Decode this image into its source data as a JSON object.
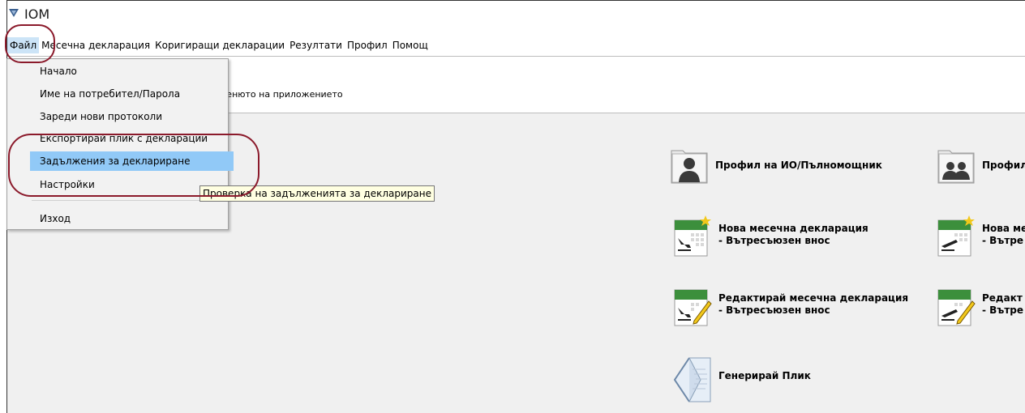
{
  "app": {
    "title": "IOM"
  },
  "menubar": {
    "items": [
      "Файл",
      "Месечна декларация",
      "Коригиращи декларации",
      "Резултати",
      "Профил",
      "Помощ"
    ]
  },
  "info_text": "менюто на приложението",
  "file_menu": {
    "items": [
      "Начало",
      "Име на потребител/Парола",
      "Зареди нови протоколи",
      "Експортирай плик с декларации",
      "Задължения за деклариране",
      "Настройки",
      "Изход"
    ],
    "highlighted": "Задължения за деклариране"
  },
  "tooltip": "Проверка на задълженията за деклариране",
  "tiles": {
    "profile_io": {
      "line1": "Профил на ИО/Пълномощник",
      "icon": "person-folder-icon"
    },
    "profile_2": {
      "line1": "Профил",
      "icon": "group-folder-icon"
    },
    "new_decl": {
      "line1": "Нова месечна декларация",
      "line2": "- Вътресъюзен внос",
      "icon": "calendar-arrival-icon"
    },
    "new_decl_2": {
      "line1": "Нова ме",
      "line2": "- Вътре",
      "icon": "calendar-departure-icon"
    },
    "edit_decl": {
      "line1": "Редактирай месечна декларация",
      "line2": "- Вътресъюзен внос",
      "icon": "calendar-edit-arrival-icon"
    },
    "edit_decl_2": {
      "line1": "Редакт",
      "line2": "- Вътре",
      "icon": "calendar-edit-departure-icon"
    },
    "envelope": {
      "line1": "Генерирай Плик",
      "icon": "envelope-icon"
    }
  },
  "colors": {
    "highlight": "#91c9f7",
    "annotation_red": "#8b1a2b",
    "tooltip_bg": "#ffffe1",
    "calendar_green": "#3c8f3c",
    "star_yellow": "#f2c81b"
  }
}
